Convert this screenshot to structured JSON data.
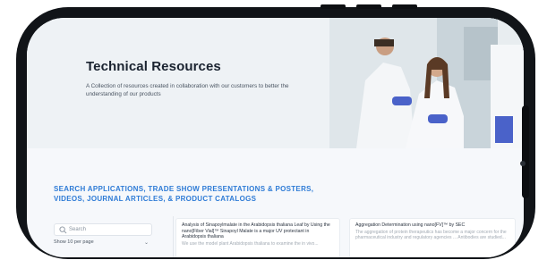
{
  "hero": {
    "title": "Technical Resources",
    "description": "A Collection of resources created in collaboration with our customers to better the understanding of our products"
  },
  "section": {
    "title": "SEARCH APPLICATIONS, TRADE SHOW PRESENTATIONS & POSTERS, VIDEOS, JOURNAL ARTICLES, & PRODUCT CATALOGS"
  },
  "sidebar": {
    "search_placeholder": "Search",
    "per_page": "Show 10 per page"
  },
  "cards": [
    {
      "title": "Analysis of Sinapoylmalate in the Arabidopsis thaliana Leaf by Using the nano[Fiber Vial]™ Sinapoyl Malate is a major UV protectant in Arabidopsis thaliana",
      "description": "We use the model plant Arabidopsis thaliana to examine the in vivo..."
    },
    {
      "title": "Aggregation Determination using nano[FV]™ by SEC",
      "description": "The aggregation of protein therapeutics has become a major concern for the pharmaceutical industry and regulatory agencies ... Antibodies are studied..."
    }
  ],
  "icons": {
    "search": "search-icon",
    "dropdown": "chevron-down-icon"
  },
  "colors": {
    "accent": "#2e7bd6",
    "phone_frame": "#111418",
    "hero_bg": "#eef2f5"
  }
}
